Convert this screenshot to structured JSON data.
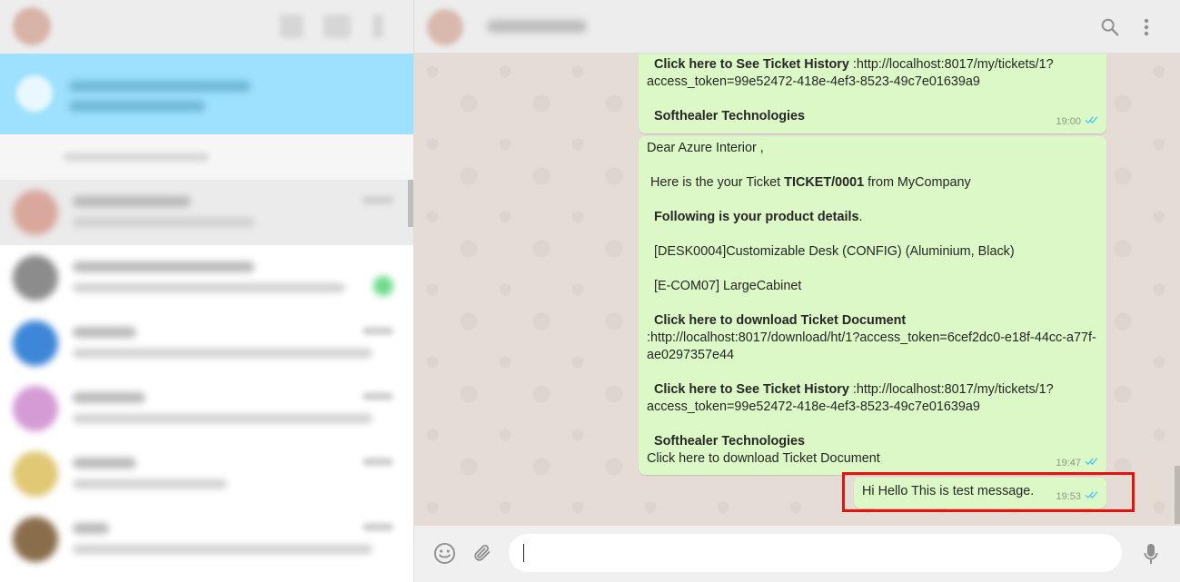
{
  "chat": {
    "messages": [
      {
        "history_label": "Click here to See Ticket History",
        "history_url": " :http://localhost:8017/my/tickets/1?",
        "history_token": "access_token=99e52472-418e-4ef3-8523-49c7e01639a9",
        "company": "Softhealer Technologies",
        "time": "19:00"
      },
      {
        "greeting": "Dear Azure Interior ,",
        "intro_prefix": " Here is the your Ticket ",
        "ticket_ref": "TICKET/0001",
        "intro_suffix": " from MyCompany",
        "details_label": "Following is your product details",
        "details_suffix": ".",
        "product_1": "[DESK0004]Customizable Desk (CONFIG) (Aluminium, Black)",
        "product_2": "[E-COM07] LargeCabinet",
        "download_label": "Click here to download Ticket Document",
        "download_url": ":http://localhost:8017/download/ht/1?access_token=6cef2dc0-e18f-44cc-a77f-",
        "download_url_2": "ae0297357e44",
        "history_label": "Click here to See Ticket History",
        "history_url": " :http://localhost:8017/my/tickets/1?",
        "history_token": "access_token=99e52472-418e-4ef3-8523-49c7e01639a9",
        "company": "Softhealer Technologies",
        "footer": "Click here to download Ticket Document",
        "time": "19:47"
      },
      {
        "text": "Hi Hello This is test message.",
        "time": "19:53"
      }
    ]
  },
  "composer": {
    "value": "",
    "placeholder": ""
  },
  "icons": {
    "search": "search-icon",
    "menu": "menu-icon",
    "emoji": "emoji-icon",
    "attach": "attach-icon",
    "mic": "mic-icon",
    "ticks": "double-check-icon"
  },
  "colors": {
    "outgoing_bubble": "#dcf8c6",
    "chat_background": "#e5ddd5",
    "read_ticks": "#4fc3f7",
    "highlight": "#e8120c",
    "sidebar_banner": "#9de1fe"
  }
}
